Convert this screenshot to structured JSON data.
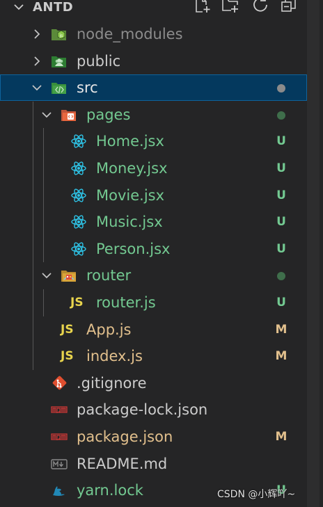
{
  "explorer": {
    "title": "ANTD",
    "header_icons": [
      "new-file-icon",
      "new-folder-icon",
      "refresh-icon",
      "collapse-all-icon"
    ]
  },
  "tree": [
    {
      "label": "node_modules",
      "kind": "folder",
      "expanded": false,
      "icon": "nodejs-folder-icon",
      "color": "#8c8c8c"
    },
    {
      "label": "public",
      "kind": "folder",
      "expanded": false,
      "icon": "public-folder-icon",
      "color": "#cccccc"
    },
    {
      "label": "src",
      "kind": "folder",
      "expanded": true,
      "icon": "src-folder-icon",
      "color": "#e6e6e6",
      "selected": true,
      "status": "dot",
      "dot_color": "#8b8b8b"
    },
    {
      "label": "pages",
      "kind": "folder",
      "expanded": true,
      "icon": "pages-folder-icon",
      "color": "#73c991",
      "status": "dot",
      "dot_color": "#3f6e4b"
    },
    {
      "label": "Home.jsx",
      "kind": "file",
      "icon": "react-icon",
      "color": "#73c991",
      "badge": "U"
    },
    {
      "label": "Money.jsx",
      "kind": "file",
      "icon": "react-icon",
      "color": "#73c991",
      "badge": "U"
    },
    {
      "label": "Movie.jsx",
      "kind": "file",
      "icon": "react-icon",
      "color": "#73c991",
      "badge": "U"
    },
    {
      "label": "Music.jsx",
      "kind": "file",
      "icon": "react-icon",
      "color": "#73c991",
      "badge": "U"
    },
    {
      "label": "Person.jsx",
      "kind": "file",
      "icon": "react-icon",
      "color": "#73c991",
      "badge": "U"
    },
    {
      "label": "router",
      "kind": "folder",
      "expanded": true,
      "icon": "router-folder-icon",
      "color": "#73c991",
      "status": "dot",
      "dot_color": "#3f6e4b"
    },
    {
      "label": "router.js",
      "kind": "file",
      "icon": "javascript-icon",
      "color": "#73c991",
      "badge": "U"
    },
    {
      "label": "App.js",
      "kind": "file",
      "icon": "javascript-icon",
      "color": "#e2c08d",
      "badge": "M"
    },
    {
      "label": "index.js",
      "kind": "file",
      "icon": "javascript-icon",
      "color": "#e2c08d",
      "badge": "M"
    },
    {
      "label": ".gitignore",
      "kind": "file",
      "icon": "git-icon",
      "color": "#cccccc"
    },
    {
      "label": "package-lock.json",
      "kind": "file",
      "icon": "npm-icon",
      "color": "#cccccc"
    },
    {
      "label": "package.json",
      "kind": "file",
      "icon": "npm-icon",
      "color": "#e2c08d",
      "badge": "M"
    },
    {
      "label": "README.md",
      "kind": "file",
      "icon": "markdown-icon",
      "color": "#cccccc"
    },
    {
      "label": "yarn.lock",
      "kind": "file",
      "icon": "yarn-icon",
      "color": "#73c991",
      "badge": "U"
    }
  ],
  "badge_colors": {
    "U": "#73c991",
    "M": "#e2c08d"
  },
  "js_icon_text": "JS",
  "watermark": "CSDN @小辉吖~"
}
